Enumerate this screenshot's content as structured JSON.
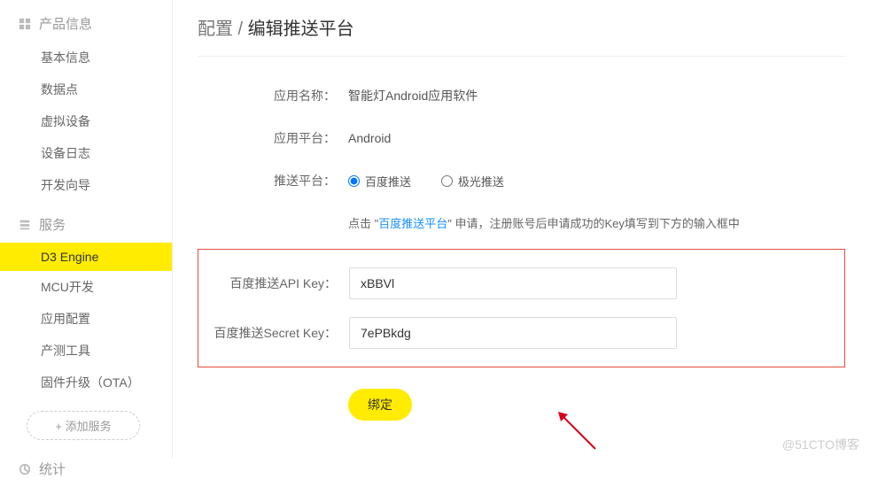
{
  "sidebar": {
    "group1": {
      "title": "产品信息"
    },
    "items1": [
      {
        "label": "基本信息"
      },
      {
        "label": "数据点"
      },
      {
        "label": "虚拟设备"
      },
      {
        "label": "设备日志"
      },
      {
        "label": "开发向导"
      }
    ],
    "group2": {
      "title": "服务"
    },
    "items2": [
      {
        "label": "D3 Engine"
      },
      {
        "label": "MCU开发"
      },
      {
        "label": "应用配置"
      },
      {
        "label": "产测工具"
      },
      {
        "label": "固件升级（OTA）"
      }
    ],
    "add_service": "+ 添加服务",
    "group3": {
      "title": "统计"
    }
  },
  "breadcrumb": {
    "parent": "配置",
    "sep": " / ",
    "current": "编辑推送平台"
  },
  "form": {
    "app_name_label": "应用名称：",
    "app_name_value": "智能灯Android应用软件",
    "platform_label": "应用平台：",
    "platform_value": "Android",
    "push_label": "推送平台：",
    "push_opt1": "百度推送",
    "push_opt2": "极光推送",
    "hint_prefix": "点击 \"",
    "hint_link": "百度推送平台",
    "hint_suffix": "\" 申请，注册账号后申请成功的Key填写到下方的输入框中",
    "api_key_label": "百度推送API Key：",
    "api_key_value": "xBBVl",
    "secret_key_label": "百度推送Secret Key：",
    "secret_key_value": "7ePBkdg",
    "bind_btn": "绑定"
  },
  "watermark": "@51CTO博客"
}
